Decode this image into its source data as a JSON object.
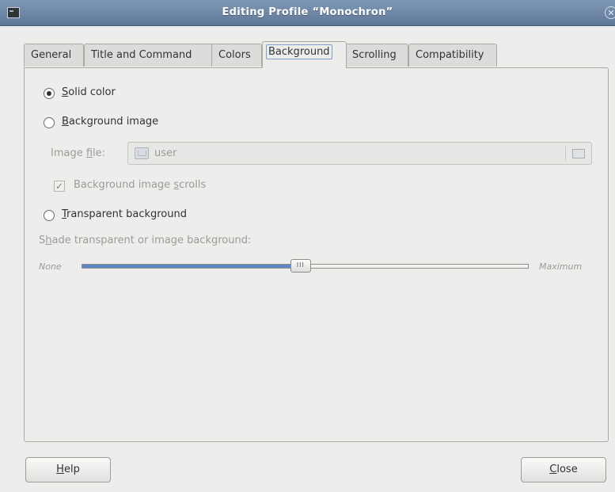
{
  "window": {
    "title": "Editing Profile “Monochron”"
  },
  "tabs": [
    {
      "label": "General"
    },
    {
      "label": "Title and Command"
    },
    {
      "label": "Colors"
    },
    {
      "label": "Background"
    },
    {
      "label": "Scrolling"
    },
    {
      "label": "Compatibility"
    }
  ],
  "background": {
    "solid": {
      "mnemonic": "S",
      "rest": "olid color",
      "selected": true
    },
    "image": {
      "mnemonic": "B",
      "rest": "ackground image"
    },
    "image_file": {
      "pre": "Image ",
      "mnemonic": "f",
      "post": "ile:",
      "value": "user"
    },
    "scrolls": {
      "pre": "Background image ",
      "mnemonic": "s",
      "post": "crolls",
      "checked": true
    },
    "transparent": {
      "mnemonic": "T",
      "rest": "ransparent background"
    },
    "shade": {
      "pre": "S",
      "mnemonic": "h",
      "post": "ade transparent or image background:"
    },
    "slider": {
      "min_label": "None",
      "max_label": "Maximum",
      "value": 0.49
    }
  },
  "buttons": {
    "help": {
      "mnemonic": "H",
      "rest": "elp"
    },
    "close": {
      "mnemonic": "C",
      "rest": "lose"
    }
  }
}
